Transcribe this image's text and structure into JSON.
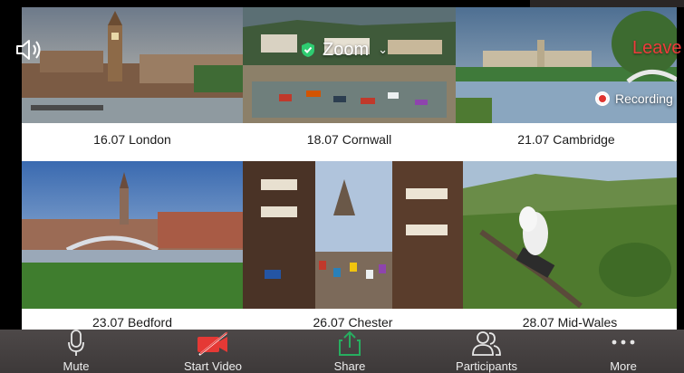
{
  "app": {
    "meeting_title": "Zoom",
    "leave_label": "Leave",
    "recording_label": "Recording",
    "colors": {
      "leave": "#ee3b3b",
      "video_off": "#e53935",
      "share": "#27ae60",
      "secure": "#2ecc71",
      "toolbar": "#444040"
    }
  },
  "gallery": {
    "tiles": [
      {
        "caption": "16.07 London"
      },
      {
        "caption": "18.07 Cornwall"
      },
      {
        "caption": "21.07 Cambridge"
      },
      {
        "caption": "23.07 Bedford"
      },
      {
        "caption": "26.07 Chester"
      },
      {
        "caption": "28.07 Mid-Wales"
      }
    ]
  },
  "toolbar": {
    "mute_label": "Mute",
    "start_video_label": "Start Video",
    "share_label": "Share",
    "participants_label": "Participants",
    "more_label": "More"
  },
  "icons": [
    "speaker-icon",
    "shield-check-icon",
    "chevron-down-icon",
    "recording-icon",
    "microphone-icon",
    "video-off-icon",
    "share-icon",
    "participants-icon",
    "more-dots-icon"
  ]
}
